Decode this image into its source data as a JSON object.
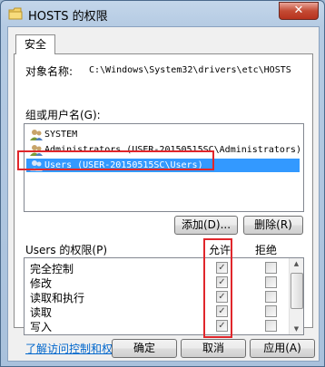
{
  "window": {
    "title": "HOSTS 的权限",
    "close_label": "✕"
  },
  "tabs": [
    {
      "label": "安全"
    }
  ],
  "object": {
    "label": "对象名称:",
    "value": "C:\\Windows\\System32\\drivers\\etc\\HOSTS"
  },
  "group_label": "组或用户名(G):",
  "users": [
    {
      "label": "SYSTEM",
      "selected": false
    },
    {
      "label": "Administrators (USER-20150515SC\\Administrators)",
      "selected": false
    },
    {
      "label": "Users (USER-20150515SC\\Users)",
      "selected": true
    }
  ],
  "buttons": {
    "add": "添加(D)...",
    "remove": "删除(R)",
    "ok": "确定",
    "cancel": "取消",
    "apply": "应用(A)"
  },
  "permissions": {
    "label": "Users 的权限(P)",
    "allow_header": "允许",
    "deny_header": "拒绝",
    "rows": [
      {
        "name": "完全控制",
        "allow": true,
        "deny": false
      },
      {
        "name": "修改",
        "allow": true,
        "deny": false
      },
      {
        "name": "读取和执行",
        "allow": true,
        "deny": false
      },
      {
        "name": "读取",
        "allow": true,
        "deny": false
      },
      {
        "name": "写入",
        "allow": true,
        "deny": false
      }
    ]
  },
  "link": "了解访问控制和权限",
  "colors": {
    "highlight": "#e0262b",
    "selection": "#3399ff",
    "link": "#0066cc"
  }
}
